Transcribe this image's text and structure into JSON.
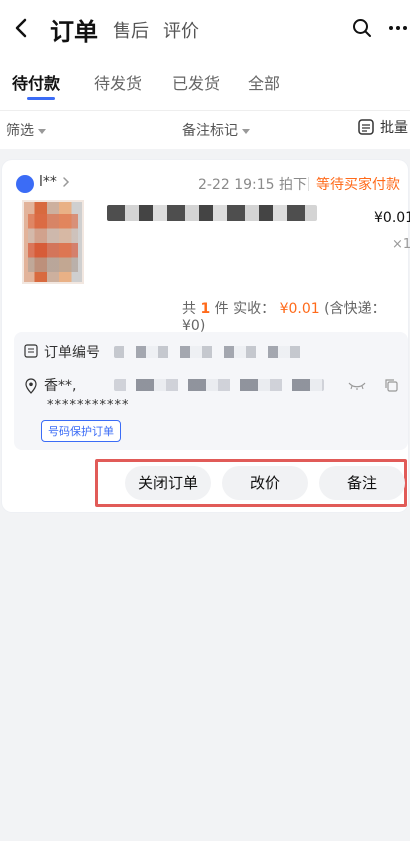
{
  "header": {
    "title": "订单",
    "sub_tabs": [
      "售后",
      "评价"
    ]
  },
  "tabs": [
    {
      "label": "待付款",
      "active": true
    },
    {
      "label": "待发货",
      "active": false
    },
    {
      "label": "已发货",
      "active": false
    },
    {
      "label": "全部",
      "active": false
    }
  ],
  "filters": {
    "filter_label": "筛选",
    "remark_label": "备注标记",
    "batch_label": "批量"
  },
  "order": {
    "buyer": "l**",
    "time": "2-22 19:15 拍下",
    "status": "等待买家付款",
    "price": "¥0.01",
    "quantity": "×1",
    "summary_prefix": "共",
    "summary_count": "1",
    "summary_mid": "件  实收：",
    "summary_amount": "¥0.01",
    "summary_suffix": "(含快递：¥0)",
    "order_no_label": "订单编号",
    "address_name": "香**,",
    "masked_phone": "***********",
    "protect_badge": "号码保护订单"
  },
  "actions": {
    "close": "关闭订单",
    "change_price": "改价",
    "remark": "备注"
  },
  "colors": {
    "accent": "#3b6cf6",
    "status": "#ff6a1a",
    "highlight_border": "#e15b58"
  }
}
